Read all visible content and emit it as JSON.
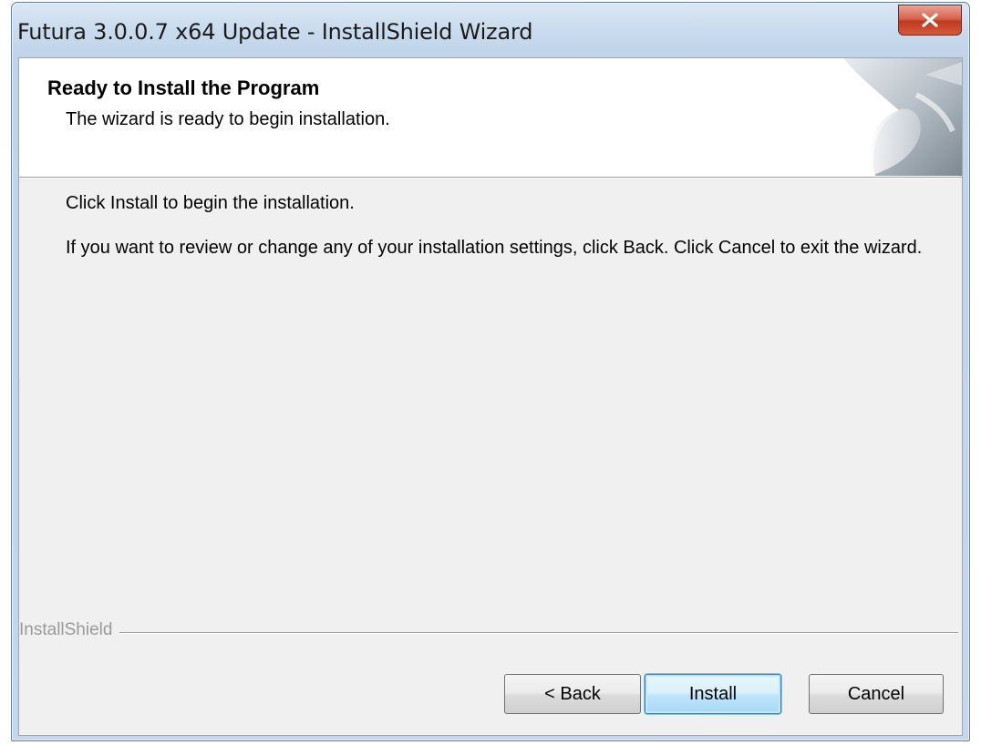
{
  "window": {
    "title": "Futura 3.0.0.7 x64 Update - InstallShield Wizard",
    "close_icon": "close-icon"
  },
  "header": {
    "title": "Ready to Install the Program",
    "subtitle": "The wizard is ready to begin installation.",
    "graphic_icon": "page-curl-graphic"
  },
  "body": {
    "line1": "Click Install to begin the installation.",
    "line2": "If you want to review or change any of your installation settings, click Back. Click Cancel to exit the wizard."
  },
  "footer": {
    "brand": "InstallShield"
  },
  "buttons": {
    "back": "< Back",
    "install": "Install",
    "cancel": "Cancel"
  },
  "colors": {
    "titlebar": "#c9dbee",
    "close_button": "#c0391f",
    "dialog_background": "#f0f0f0",
    "default_button_border": "#3c7fb1"
  }
}
